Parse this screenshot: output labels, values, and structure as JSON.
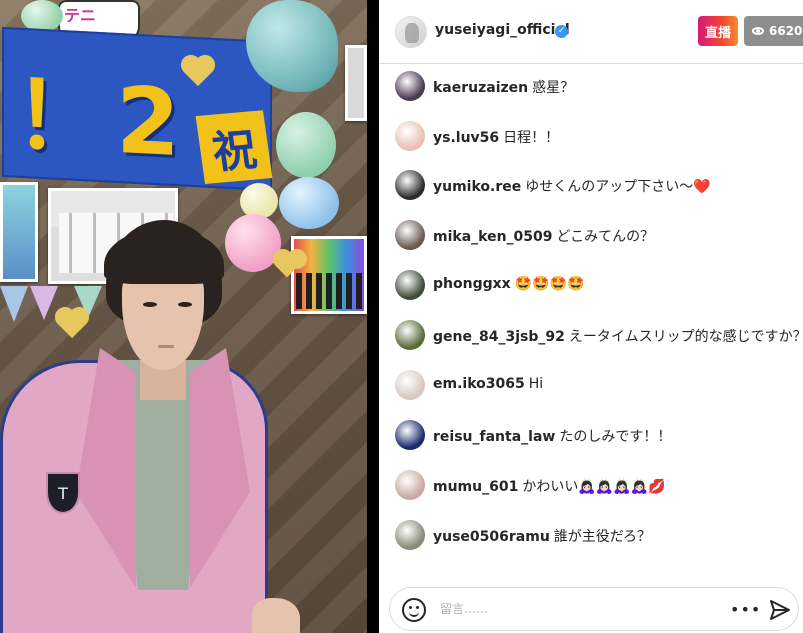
{
  "header": {
    "username": "yuseiyagi_official",
    "live_label": "直播",
    "viewer_count": "6620"
  },
  "video": {
    "banner_text": "！2",
    "banner_kanji": "祝",
    "speech_text": "テニ",
    "emblem_text": "T"
  },
  "comments": [
    {
      "user": "kaeruzaizen",
      "text": "惑星？",
      "avatar_color": "#4a3a52"
    },
    {
      "user": "ys.luv56",
      "text": "日程！！",
      "avatar_color": "#e7c2b4"
    },
    {
      "user": "yumiko.ree",
      "text": "ゆせくんのアップ下さい〜❤️",
      "avatar_color": "#2b2b2b"
    },
    {
      "user": "mika_ken_0509",
      "text": "どこみてんの？",
      "avatar_color": "#6a5a52"
    },
    {
      "user": "phonggxx",
      "text": "🤩🤩🤩🤩",
      "avatar_color": "#3f4a3a"
    },
    {
      "user": "gene_84_3jsb_92",
      "text": "えータイムスリップ的な感じですか？",
      "avatar_color": "#5a6a3a"
    },
    {
      "user": "em.iko3065",
      "text": "Hi",
      "avatar_color": "#d8c8c0"
    },
    {
      "user": "reisu_fanta_law",
      "text": "たのしみです！！",
      "avatar_color": "#1a2a6a"
    },
    {
      "user": "mumu_601",
      "text": "かわいい🙇🏻‍♀️🙇🏻‍♀️🙇🏻‍♀️🙇🏻‍♀️💋",
      "avatar_color": "#c9a9a0"
    },
    {
      "user": "yuse0506ramu",
      "text": "誰が主役だろ？",
      "avatar_color": "#8a8a7a"
    }
  ],
  "composer": {
    "placeholder": "留言……",
    "more_label": "•••"
  },
  "icons": {
    "verified": "verified-badge-icon",
    "eye": "eye-icon",
    "emoji": "emoji-icon",
    "more": "more-options-icon",
    "send": "send-icon"
  },
  "colors": {
    "live_gradient_start": "#d6197a",
    "live_gradient_end": "#fb8b2f",
    "verified": "#3897f0",
    "viewer_badge": "#8e8e8e"
  }
}
